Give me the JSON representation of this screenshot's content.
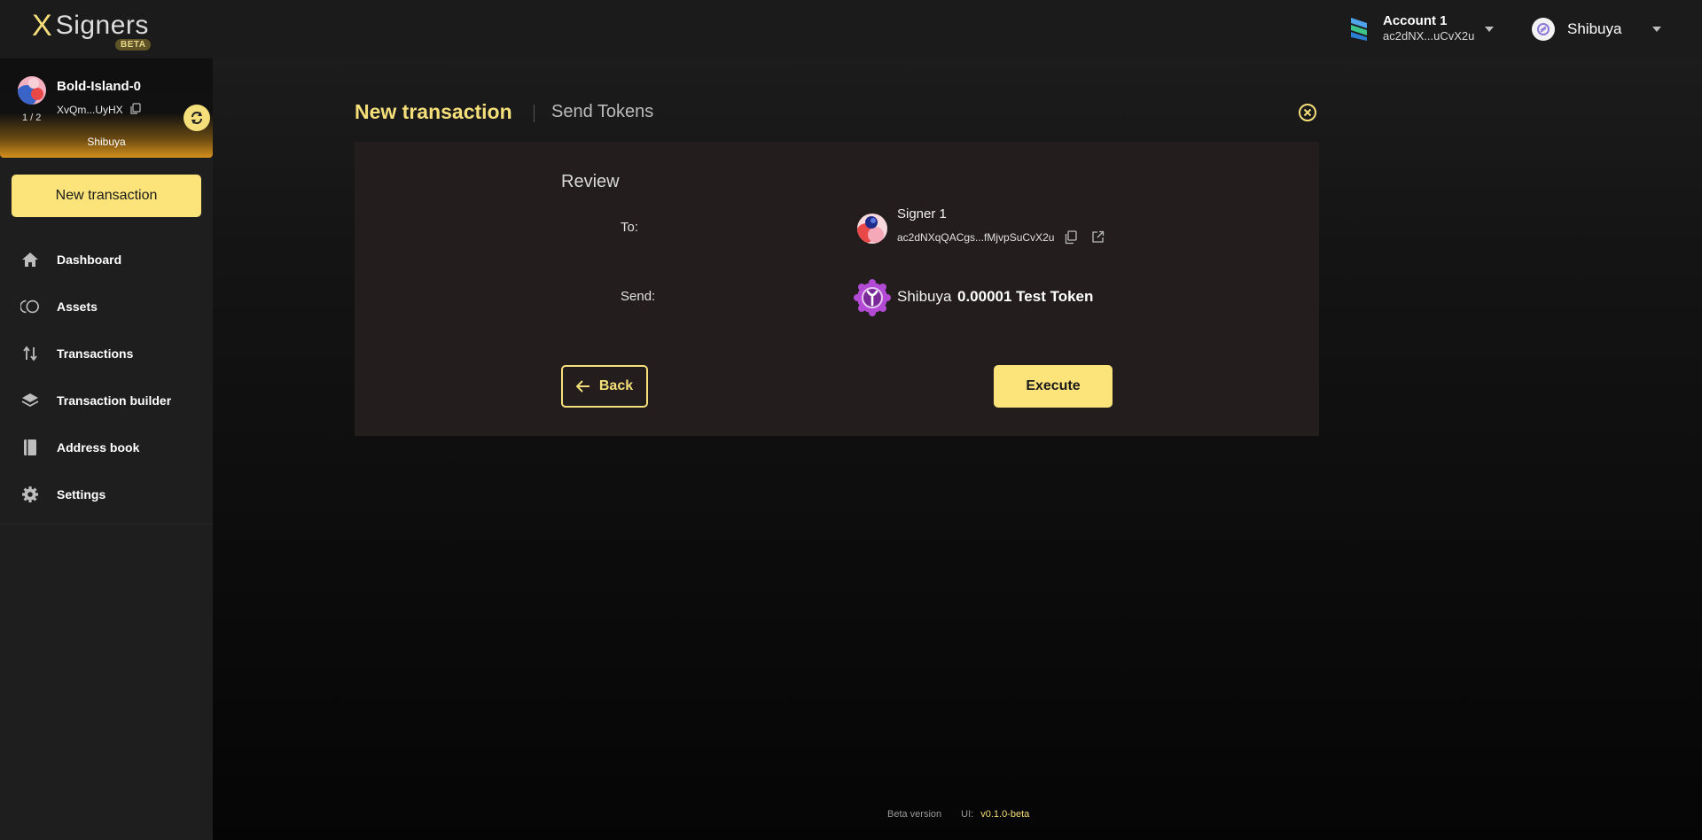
{
  "header": {
    "logo_mark": "X",
    "logo_text": "Signers",
    "beta_badge": "BETA",
    "account_name": "Account 1",
    "account_address": "ac2dNX...uCvX2u",
    "network_name": "Shibuya"
  },
  "sidebar": {
    "multisig": {
      "name": "Bold-Island-0",
      "address": "XvQm...UyHX",
      "threshold": "1 / 2",
      "network": "Shibuya"
    },
    "new_transaction_label": "New transaction",
    "items": [
      {
        "label": "Dashboard",
        "icon": "home-icon"
      },
      {
        "label": "Assets",
        "icon": "assets-icon"
      },
      {
        "label": "Transactions",
        "icon": "arrows-updown-icon"
      },
      {
        "label": "Transaction builder",
        "icon": "layers-icon"
      },
      {
        "label": "Address book",
        "icon": "book-icon"
      },
      {
        "label": "Settings",
        "icon": "gear-icon"
      }
    ]
  },
  "main": {
    "title": "New transaction",
    "subtitle": "Send Tokens",
    "review": {
      "title": "Review",
      "to_label": "To:",
      "signer_name": "Signer 1",
      "signer_address": "ac2dNXqQACgs...fMjvpSuCvX2u",
      "send_label": "Send:",
      "token_network": "Shibuya",
      "amount": "0.00001 Test Token"
    },
    "back_label": "Back",
    "execute_label": "Execute"
  },
  "footer": {
    "beta_text": "Beta version",
    "ui_label": "UI:",
    "version": "v0.1.0-beta"
  },
  "colors": {
    "accent": "#fde47a",
    "card_bg": "#231e1d",
    "sidebar_bg": "#1e1e1e"
  }
}
